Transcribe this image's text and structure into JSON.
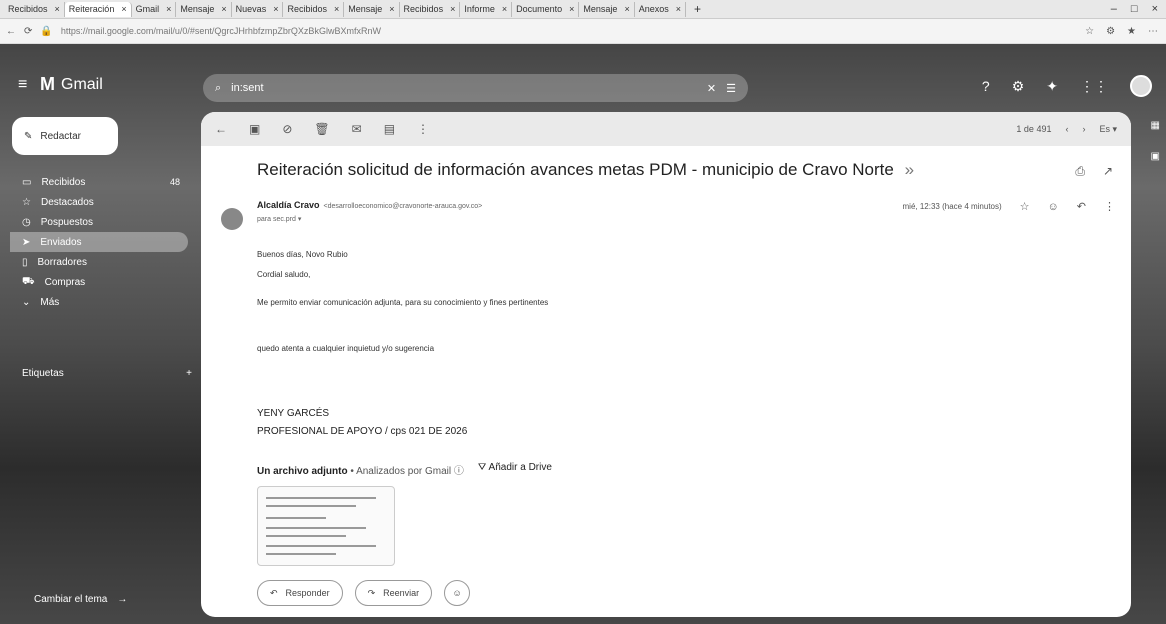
{
  "browser": {
    "tabs": [
      {
        "label": "Recibidos",
        "active": false
      },
      {
        "label": "Reiteración",
        "active": true
      },
      {
        "label": "Gmail",
        "active": false
      },
      {
        "label": "Mensaje",
        "active": false
      },
      {
        "label": "Nuevas",
        "active": false
      },
      {
        "label": "Recibidos",
        "active": false
      },
      {
        "label": "Mensaje",
        "active": false
      },
      {
        "label": "Recibidos",
        "active": false
      },
      {
        "label": "Informe",
        "active": false
      },
      {
        "label": "Documento",
        "active": false
      },
      {
        "label": "Mensaje",
        "active": false
      },
      {
        "label": "Anexos",
        "active": false
      }
    ],
    "new_tab": "+",
    "url": "https://mail.google.com/mail/u/0/#sent/QgrcJHrhbfzmpZbrQXzBkGlwBXmfxRnW",
    "window_controls": [
      "–",
      "□",
      "×"
    ]
  },
  "header": {
    "app_name": "Gmail",
    "search_value": "in:sent"
  },
  "sidebar": {
    "compose_label": "Redactar",
    "items": [
      {
        "label": "Recibidos",
        "count": "48",
        "selected": false,
        "icon": "inbox-icon"
      },
      {
        "label": "Destacados",
        "count": "",
        "selected": false,
        "icon": "star-icon"
      },
      {
        "label": "Pospuestos",
        "count": "",
        "selected": false,
        "icon": "clock-icon"
      },
      {
        "label": "Enviados",
        "count": "",
        "selected": true,
        "icon": "send-icon"
      },
      {
        "label": "Borradores",
        "count": "",
        "selected": false,
        "icon": "draft-icon"
      },
      {
        "label": "Compras",
        "count": "",
        "selected": false,
        "icon": "cart-icon"
      },
      {
        "label": "Más",
        "count": "",
        "selected": false,
        "icon": "chevron-down-icon"
      }
    ],
    "labels_heading": "Etiquetas",
    "theme_label": "Cambiar el tema"
  },
  "toolbar": {
    "pagination": "1 de 491"
  },
  "email": {
    "subject": "Reiteración solicitud de información avances metas PDM - municipio de Cravo Norte",
    "subject_tag": "»",
    "sender_name": "Alcaldía Cravo",
    "sender_address": "<desarrolloeconomico@cravonorte-arauca.gov.co>",
    "to_line": "para sec.prd ▾",
    "date": "mié, 12:33 (hace 4 minutos)",
    "body": [
      "Buenos días, Novo Rubio",
      "Cordial saludo,",
      "Me permito enviar comunicación adjunta, para su conocimiento y fines pertinentes",
      "quedo atenta a cualquier inquietud y/o sugerencia"
    ],
    "signature_name": "YENY GARCÉS",
    "signature_role": "PROFESIONAL DE APOYO / cps 021 DE 2026",
    "attachment_heading": "Un archivo adjunto",
    "attachment_scan": "• Analizados por Gmail ⓘ",
    "add_to_drive": "Añadir a Drive",
    "reply_label": "Responder",
    "forward_label": "Reenviar"
  }
}
